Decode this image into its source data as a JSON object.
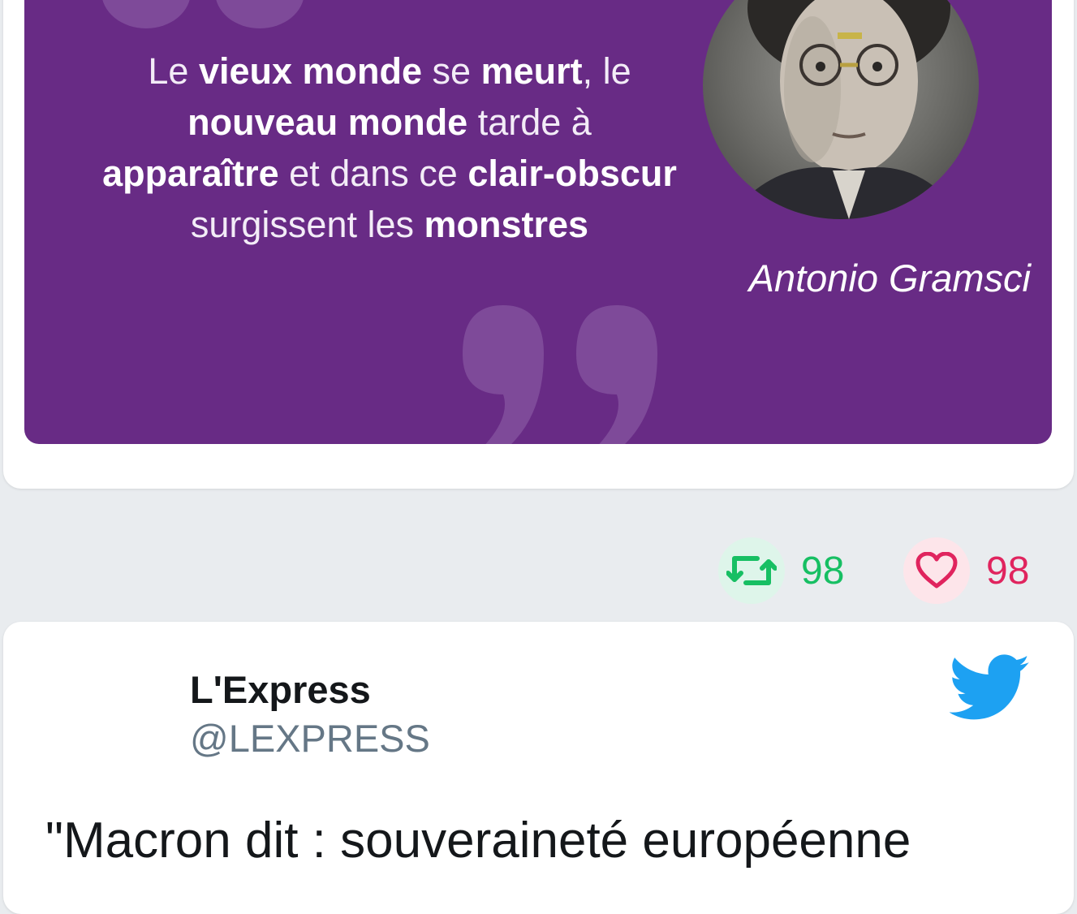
{
  "embedded_quote": {
    "text_segments": [
      {
        "text": "Le ",
        "bold": false
      },
      {
        "text": "vieux monde",
        "bold": true
      },
      {
        "text": " se ",
        "bold": false
      },
      {
        "text": "meurt",
        "bold": true
      },
      {
        "text": ", le ",
        "bold": false
      },
      {
        "text": "nouveau monde",
        "bold": true
      },
      {
        "text": " tarde à ",
        "bold": false
      },
      {
        "text": "apparaître",
        "bold": true
      },
      {
        "text": " et dans ce ",
        "bold": false
      },
      {
        "text": "clair-obscur",
        "bold": true
      },
      {
        "text": " surgissent les ",
        "bold": false
      },
      {
        "text": "monstres",
        "bold": true
      }
    ],
    "author": "Antonio Gramsci",
    "background_color": "#682b85"
  },
  "tweet_actions": {
    "retweet_count": "98",
    "like_count": "98",
    "retweet_color": "#17bf63",
    "like_color": "#e0245e"
  },
  "next_tweet": {
    "author_name": "L'Express",
    "author_handle": "@LEXPRESS",
    "text": "\"Macron dit : souveraineté européenne",
    "logo": "twitter-bird-icon",
    "logo_color": "#1da1f2"
  }
}
